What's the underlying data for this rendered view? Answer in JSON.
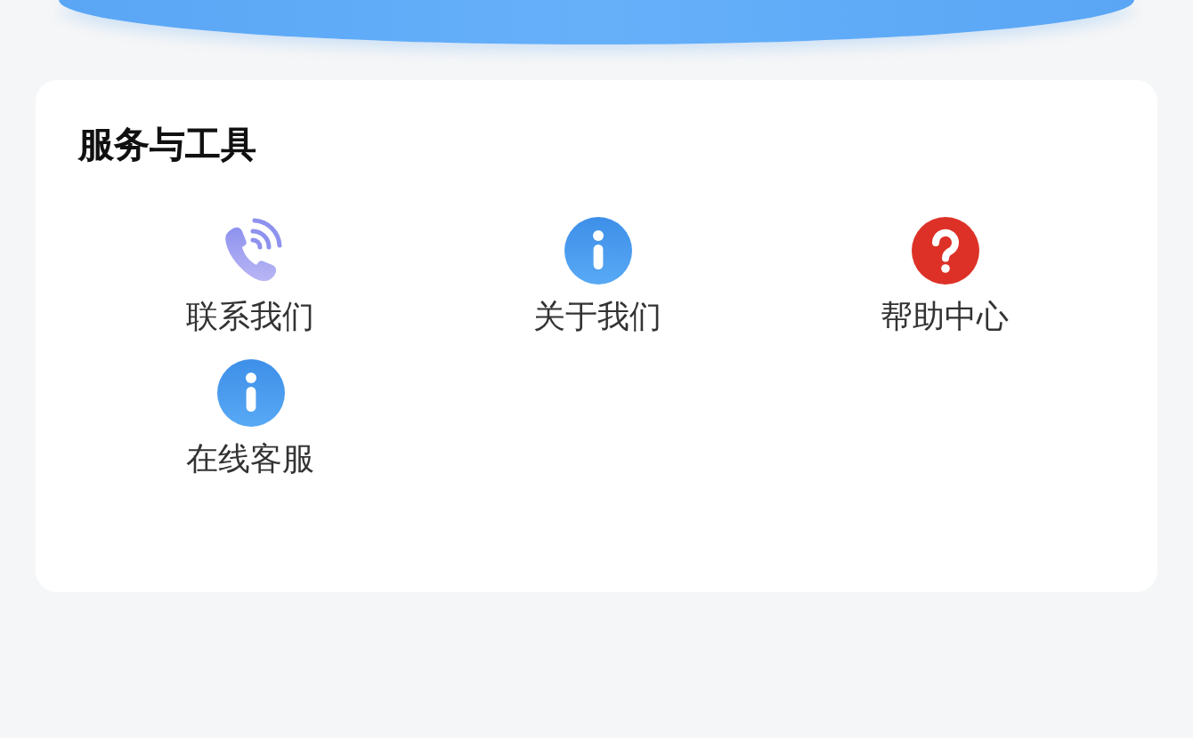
{
  "section": {
    "title": "服务与工具",
    "items": [
      {
        "label": "联系我们",
        "kind": "phone"
      },
      {
        "label": "关于我们",
        "kind": "info"
      },
      {
        "label": "帮助中心",
        "kind": "help"
      },
      {
        "label": "在线客服",
        "kind": "info"
      }
    ]
  }
}
